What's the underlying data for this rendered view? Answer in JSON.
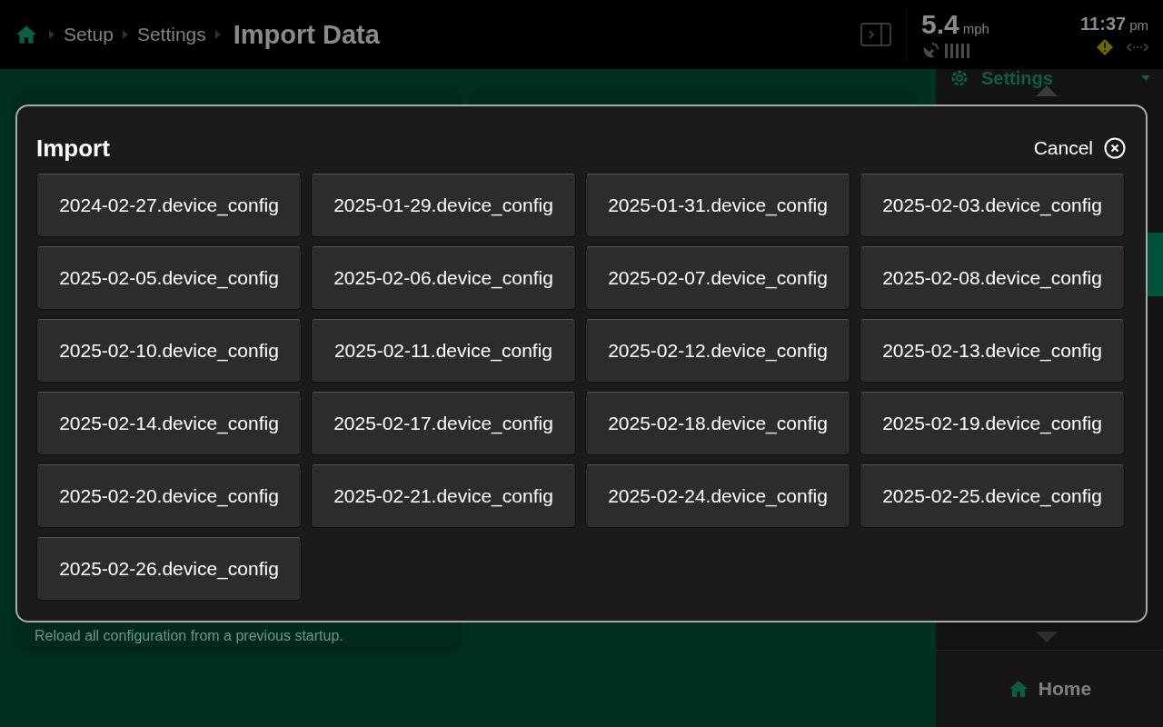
{
  "top_bar": {
    "breadcrumb": [
      {
        "label": "Setup"
      },
      {
        "label": "Settings"
      }
    ],
    "title": "Import Data",
    "speed": "5.4",
    "speed_unit": "mph",
    "time": "11:37",
    "time_period": "pm"
  },
  "sidebar": {
    "header": "Settings",
    "home_label": "Home"
  },
  "card": {
    "description": "Reload all configuration from a previous startup."
  },
  "dialog": {
    "title": "Import",
    "cancel_label": "Cancel",
    "files": [
      {
        "label": "2024-02-27.device_config"
      },
      {
        "label": "2025-01-29.device_config"
      },
      {
        "label": "2025-01-31.device_config"
      },
      {
        "label": "2025-02-03.device_config"
      },
      {
        "label": "2025-02-05.device_config"
      },
      {
        "label": "2025-02-06.device_config"
      },
      {
        "label": "2025-02-07.device_config"
      },
      {
        "label": "2025-02-08.device_config"
      },
      {
        "label": "2025-02-10.device_config"
      },
      {
        "label": "2025-02-11.device_config"
      },
      {
        "label": "2025-02-12.device_config"
      },
      {
        "label": "2025-02-13.device_config"
      },
      {
        "label": "2025-02-14.device_config"
      },
      {
        "label": "2025-02-17.device_config"
      },
      {
        "label": "2025-02-18.device_config"
      },
      {
        "label": "2025-02-19.device_config"
      },
      {
        "label": "2025-02-20.device_config"
      },
      {
        "label": "2025-02-21.device_config"
      },
      {
        "label": "2025-02-24.device_config"
      },
      {
        "label": "2025-02-25.device_config"
      },
      {
        "label": "2025-02-26.device_config"
      }
    ]
  }
}
